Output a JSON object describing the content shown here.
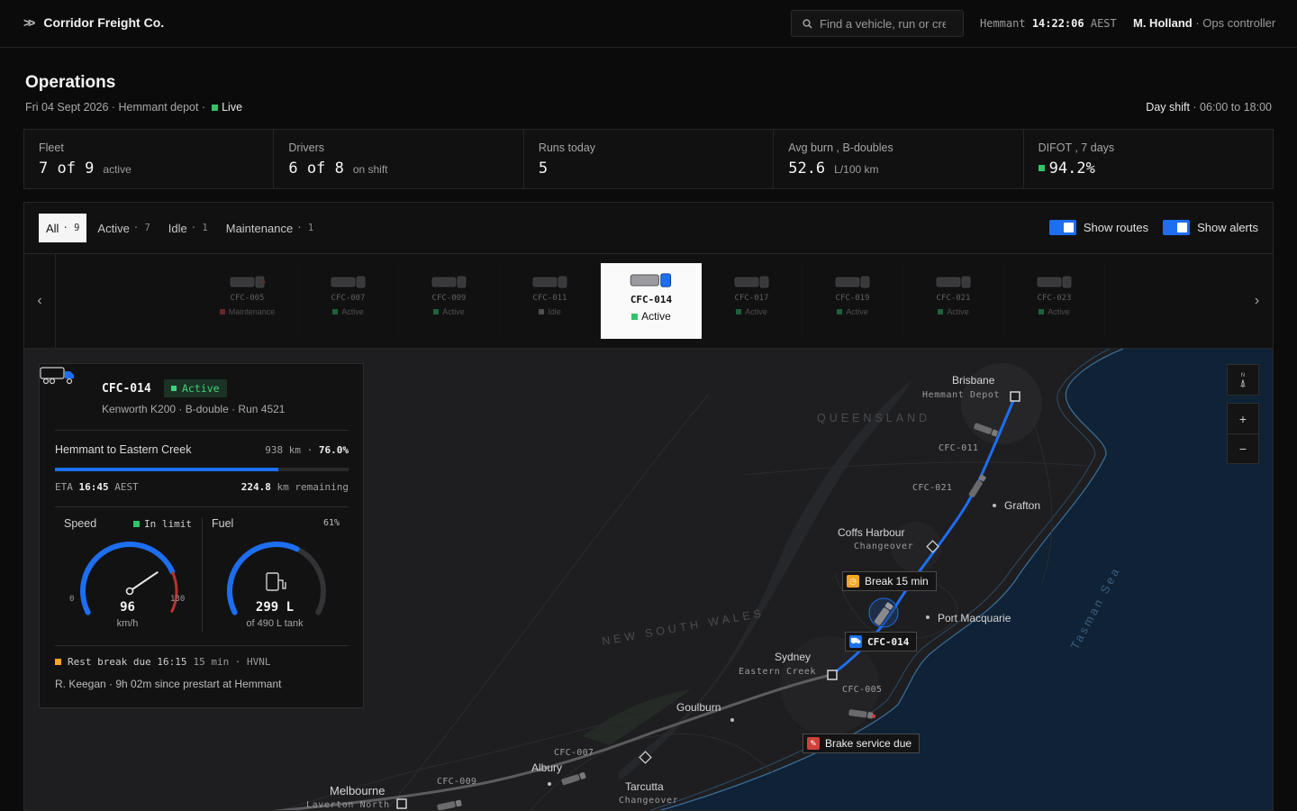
{
  "app": {
    "brand": "Corridor Freight Co.",
    "search_placeholder": "Find a vehicle, run or crew",
    "clock_location": "Hemmant",
    "clock_time": "14:22:06",
    "clock_tz": "AEST",
    "user_name": "M. Holland",
    "user_role": "· Ops controller"
  },
  "header": {
    "title": "Operations",
    "subtitle": "Fri 04 Sept 2026 · Hemmant depot ·",
    "live": "Live",
    "shift_label": "Day shift",
    "shift_hours": "· 06:00 to 18:00"
  },
  "kpis": [
    {
      "label": "Fleet",
      "value": "7 of 9",
      "unit": "active"
    },
    {
      "label": "Drivers",
      "value": "6 of 8",
      "unit": "on shift"
    },
    {
      "label": "Runs today",
      "value": "5",
      "unit": ""
    },
    {
      "label": "Avg burn , B-doubles",
      "value": "52.6",
      "unit": "L/100 km"
    },
    {
      "label": "DIFOT , 7 days",
      "value": "94.2%",
      "unit": ""
    }
  ],
  "filters": {
    "tabs": [
      {
        "label": "All",
        "count": "· 9"
      },
      {
        "label": "Active",
        "count": "· 7"
      },
      {
        "label": "Idle",
        "count": "· 1"
      },
      {
        "label": "Maintenance",
        "count": "· 1"
      }
    ],
    "show_routes": "Show routes",
    "show_alerts": "Show alerts"
  },
  "vehicles": [
    {
      "id": "CFC-005",
      "status": "Maintenance",
      "color": "#d0413b"
    },
    {
      "id": "CFC-007",
      "status": "Active",
      "color": "#2fc46a"
    },
    {
      "id": "CFC-009",
      "status": "Active",
      "color": "#2fc46a"
    },
    {
      "id": "CFC-011",
      "status": "Idle",
      "color": "#9a9a9a"
    },
    {
      "id": "CFC-014",
      "status": "Active",
      "color": "#2fc46a"
    },
    {
      "id": "CFC-017",
      "status": "Active",
      "color": "#2fc46a"
    },
    {
      "id": "CFC-019",
      "status": "Active",
      "color": "#2fc46a"
    },
    {
      "id": "CFC-021",
      "status": "Active",
      "color": "#2fc46a"
    },
    {
      "id": "CFC-023",
      "status": "Active",
      "color": "#2fc46a"
    }
  ],
  "selected": {
    "id": "CFC-014",
    "status": "Active",
    "desc": "Kenworth K200 · B-double · Run 4521",
    "route": "Hemmant to Eastern Creek",
    "route_km": "938 km ·",
    "route_pct": "76.0%",
    "progress": 0.76,
    "eta_label": "ETA",
    "eta": "16:45",
    "eta_tz": "AEST",
    "remaining": "224.8",
    "remaining_unit": "km remaining",
    "speed_label": "Speed",
    "speed_tag": "In limit",
    "speed": "96",
    "speed_value": 96,
    "speed_max": 130,
    "speed_min_label": "0",
    "speed_max_label": "130",
    "speed_unit": "km/h",
    "fuel_label": "Fuel",
    "fuel_pct": "61%",
    "fuel_fraction": 0.61,
    "fuel": "299 L",
    "fuel_tank": "of 490 L tank",
    "rest": "Rest break due 16:15",
    "rest_meta": "15 min · HVNL",
    "driver": "R. Keegan · 9h 02m since prestart at Hemmant"
  },
  "map": {
    "regions": [
      "QUEENSLAND",
      "NEW SOUTH WALES"
    ],
    "sea": "Tasman Sea",
    "places": {
      "brisbane": "Brisbane",
      "brisbane_sub": "Hemmant Depot",
      "grafton": "Grafton",
      "coffs": "Coffs Harbour",
      "coffs_sub": "Changeover",
      "port": "Port Macquarie",
      "sydney": "Sydney",
      "sydney_sub": "Eastern Creek",
      "goulburn": "Goulburn",
      "albury": "Albury",
      "tarcutta": "Tarcutta",
      "tarcutta_sub": "Changeover",
      "melbourne": "Melbourne",
      "melbourne_sub": "Laverton North"
    },
    "vehicle_labels": [
      "CFC-011",
      "CFC-021",
      "CFC-005",
      "CFC-007",
      "CFC-009"
    ],
    "alerts": {
      "break": "Break 15 min",
      "selected": "CFC-014",
      "brake": "Brake service due"
    },
    "compass": "N",
    "zoom_in": "+",
    "zoom_out": "−"
  },
  "colors": {
    "accent": "#1d6ef0",
    "ok": "#2fc46a",
    "warn": "#f5a623",
    "danger": "#d0413b"
  }
}
